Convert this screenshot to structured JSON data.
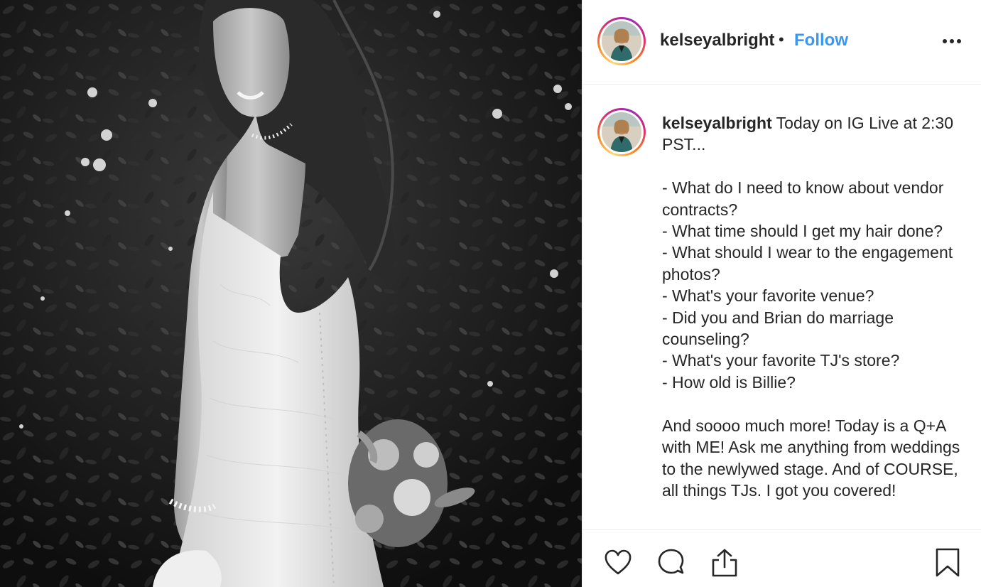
{
  "post": {
    "photo_alt": "",
    "header": {
      "username": "kelseyalbright",
      "separator": "•",
      "follow_label": "Follow",
      "more_icon": "more-options-icon"
    },
    "caption": {
      "username": "kelseyalbright",
      "text": " Today on IG Live at 2:30 PST...\n\n- What do I need to know about vendor contracts?\n- What time should I get my hair done?\n- What should I wear to the engagement photos?\n- What's your favorite venue?\n- Did you and Brian do marriage counseling?\n- What's your favorite TJ's store?\n- How old is Billie?\n\nAnd soooo much more! Today is a Q+A with ME! Ask me anything from weddings to the newlywed stage. And of COURSE, all things TJs. I got you covered!"
    },
    "actions": {
      "like_icon": "heart-icon",
      "comment_icon": "comment-icon",
      "share_icon": "share-icon",
      "save_icon": "bookmark-icon"
    },
    "colors": {
      "follow": "#3897f0",
      "text": "#262626",
      "divider": "#efefef"
    }
  }
}
